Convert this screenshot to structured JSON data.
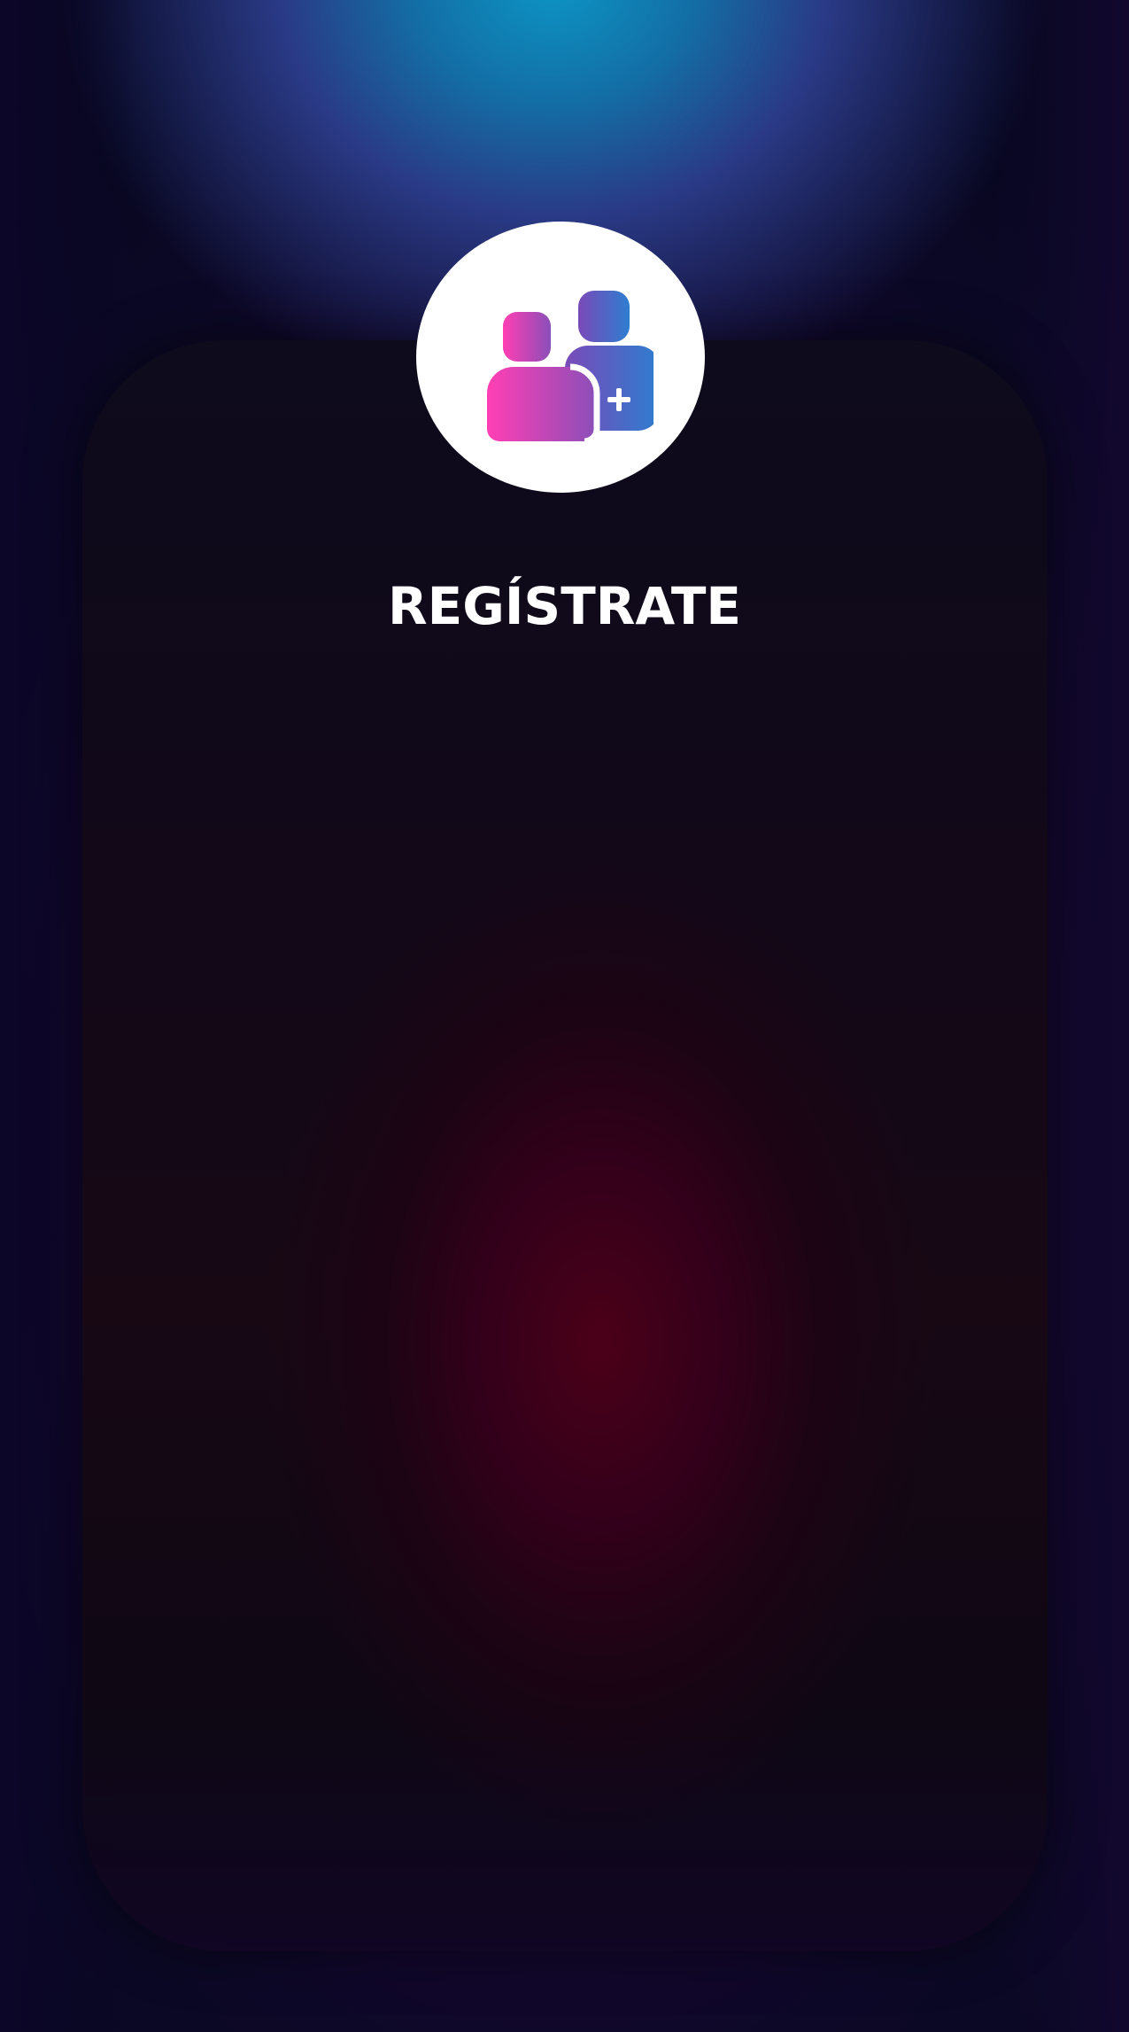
{
  "register": {
    "title": "REGÍSTRATE",
    "icon": "add-user-icon"
  },
  "colors": {
    "icon_gradient_start": "#ff3fb4",
    "icon_gradient_end": "#2d7ed0",
    "title_text": "#ffffff",
    "circle_bg": "#ffffff"
  }
}
